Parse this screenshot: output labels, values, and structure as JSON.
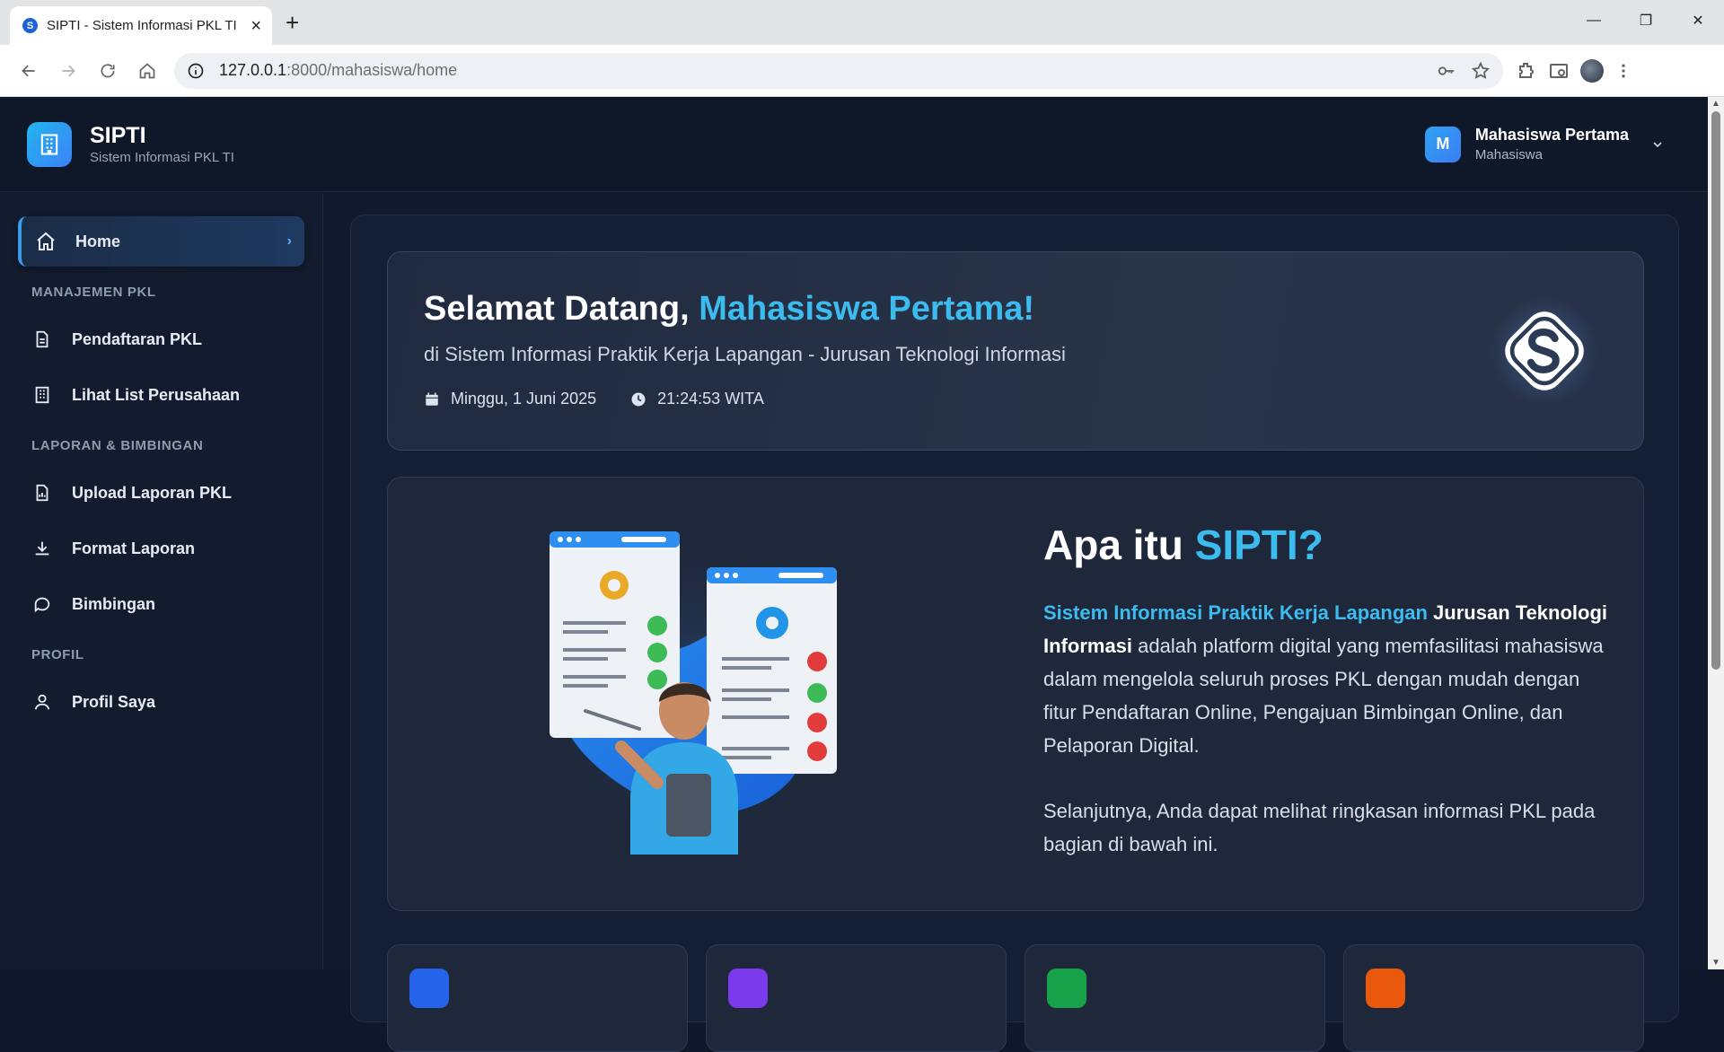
{
  "browser": {
    "tab_title": "SIPTI - Sistem Informasi PKL TI",
    "url_host": "127.0.0.1",
    "url_path": ":8000/mahasiswa/home"
  },
  "header": {
    "brand_name": "SIPTI",
    "brand_subtitle": "Sistem Informasi PKL TI",
    "user_initial": "M",
    "user_name": "Mahasiswa Pertama",
    "user_role": "Mahasiswa"
  },
  "sidebar": {
    "home": "Home",
    "section_pkl": "MANAJEMEN PKL",
    "pendaftaran": "Pendaftaran PKL",
    "perusahaan": "Lihat List Perusahaan",
    "section_laporan": "LAPORAN & BIMBINGAN",
    "upload": "Upload Laporan PKL",
    "format": "Format Laporan",
    "bimbingan": "Bimbingan",
    "section_profil": "PROFIL",
    "profil": "Profil Saya"
  },
  "welcome": {
    "greeting": "Selamat Datang, ",
    "name": "Mahasiswa Pertama!",
    "subtitle": "di Sistem Informasi Praktik Kerja Lapangan - Jurusan Teknologi Informasi",
    "date": "Minggu, 1 Juni 2025",
    "time": "21:24:53 WITA"
  },
  "about": {
    "title_prefix": "Apa itu ",
    "title_highlight": "SIPTI?",
    "p1_highlight": "Sistem Informasi Praktik Kerja Lapangan",
    "p1_bold": " Jurusan Teknologi Informasi",
    "p1_rest": " adalah platform digital yang memfasilitasi mahasiswa dalam mengelola seluruh proses PKL dengan mudah dengan fitur Pendaftaran Online, Pengajuan Bimbingan Online, dan Pelaporan Digital.",
    "p2": "Selanjutnya, Anda dapat melihat ringkasan informasi PKL pada bagian di bawah ini."
  },
  "colors": {
    "accent": "#3cbcee",
    "bg": "#111a2c",
    "card_icons": [
      "#2563eb",
      "#7c3aed",
      "#16a34a",
      "#ea580c"
    ]
  }
}
